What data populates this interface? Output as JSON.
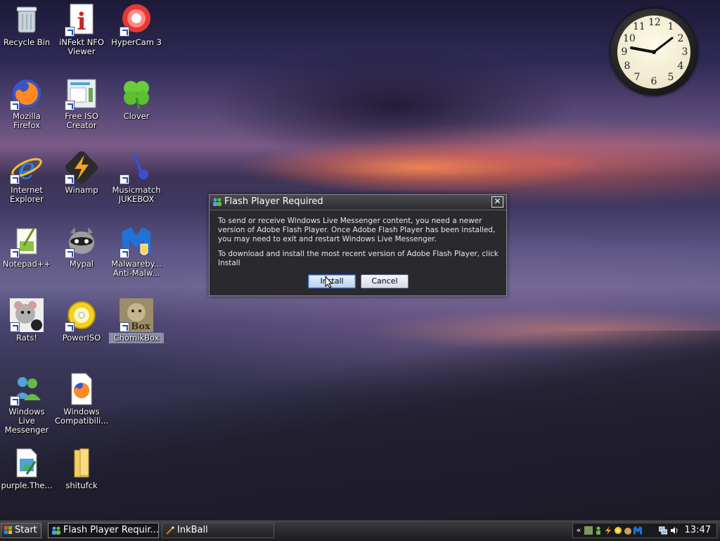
{
  "desktop": {
    "icons": [
      {
        "label": "Recycle Bin",
        "glyph": "🗑",
        "color": "#cfd8e0"
      },
      {
        "label": "iNFekt NFO Viewer",
        "glyph": "i",
        "color": "#d32f2f"
      },
      {
        "label": "HyperCam 3",
        "glyph": "●",
        "color": "#e53935"
      },
      {
        "label": "Mozilla Firefox",
        "glyph": "🦊",
        "color": "#ff8f00"
      },
      {
        "label": "Free ISO Creator",
        "glyph": "▤",
        "color": "#4fa3d9"
      },
      {
        "label": "Clover",
        "glyph": "☘",
        "color": "#5ccc3a"
      },
      {
        "label": "Internet Explorer",
        "glyph": "e",
        "color": "#1e88e5"
      },
      {
        "label": "Winamp",
        "glyph": "⚡",
        "color": "#f0a020"
      },
      {
        "label": "Musicmatch JUKEBOX",
        "glyph": "♪",
        "color": "#3a4fd0"
      },
      {
        "label": "Notepad++",
        "glyph": "✎",
        "color": "#8bc34a"
      },
      {
        "label": "Mypal",
        "glyph": "◉",
        "color": "#9e9e9e"
      },
      {
        "label": "Malwareby... Anti-Malw...",
        "glyph": "M",
        "color": "#1e88e5"
      },
      {
        "label": "Rats!",
        "glyph": "🐀",
        "color": "#aaaaaa"
      },
      {
        "label": "PowerISO",
        "glyph": "◎",
        "color": "#f5c518"
      },
      {
        "label": "ChomikBox",
        "glyph": "Box",
        "color": "#8a7a5a"
      },
      {
        "label": "Windows Live Messenger",
        "glyph": "👥",
        "color": "#4caf50"
      },
      {
        "label": "Windows Compatibili...",
        "glyph": "🦊",
        "color": "#ff8f00"
      },
      {
        "label": "purple.The...",
        "glyph": "🖼",
        "color": "#4fa3d9"
      },
      {
        "label": "shitufck",
        "glyph": "📁",
        "color": "#f0c040"
      }
    ]
  },
  "clock": {
    "numerals": [
      "12",
      "1",
      "2",
      "3",
      "4",
      "5",
      "6",
      "7",
      "8",
      "9",
      "10",
      "11"
    ]
  },
  "dialog": {
    "title": "Flash Player Required",
    "close": "✕",
    "message1": "To send or receive Windows Live Messenger content, you need a newer version of Adobe Flash Player.  Once Adobe Flash Player has been installed, you may need to exit and restart Windows Live Messenger.",
    "message2": "To download and install the most recent version of Adobe Flash Player, click Install",
    "install": "Install",
    "cancel": "Cancel"
  },
  "taskbar": {
    "start": "Start",
    "windows": [
      {
        "label": "Flash Player Requir...",
        "icon": "👥",
        "active": true
      },
      {
        "label": "InkBall",
        "icon": "✎",
        "active": false
      }
    ],
    "tray": {
      "expand": "«",
      "time": "13:47",
      "icons": [
        "app-icon",
        "messenger-icon",
        "winamp-icon",
        "powerISO-icon",
        "hamster-icon",
        "malwarebytes-icon",
        "network-icon",
        "volume-icon"
      ]
    }
  }
}
